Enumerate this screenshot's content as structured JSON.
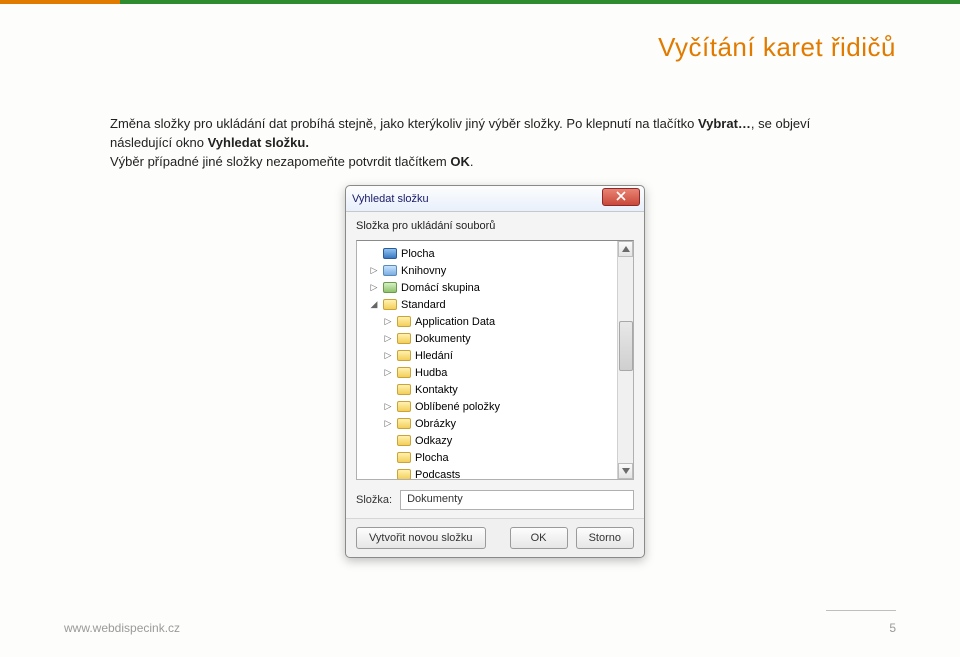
{
  "page": {
    "title": "Vyčítání karet řidičů",
    "paragraph_parts": {
      "p1a": "Změna složky pro ukládání dat probíhá stejně, jako kterýkoliv jiný výběr složky. Po klepnutí na tlačítko ",
      "p1b": "Vybrat…",
      "p1c": ", se objeví následující okno ",
      "p1d": "Vyhledat složku.",
      "p2a": "Výběr případné jiné složky nezapomeňte potvrdit tlačítkem ",
      "p2b": "OK",
      "p2c": "."
    },
    "footer_url": "www.webdispecink.cz",
    "footer_page": "5"
  },
  "dialog": {
    "title": "Vyhledat složku",
    "subtitle": "Složka pro ukládání souborů",
    "folder_label": "Složka:",
    "folder_value": "Dokumenty",
    "btn_new_folder": "Vytvořit novou složku",
    "btn_ok": "OK",
    "btn_cancel": "Storno",
    "tree": [
      {
        "level": 1,
        "expander": "",
        "icon": "desktop",
        "label": "Plocha"
      },
      {
        "level": 1,
        "expander": "▷",
        "icon": "lib",
        "label": "Knihovny"
      },
      {
        "level": 1,
        "expander": "▷",
        "icon": "group",
        "label": "Domácí skupina"
      },
      {
        "level": 1,
        "expander": "◢",
        "icon": "folder",
        "label": "Standard"
      },
      {
        "level": 2,
        "expander": "▷",
        "icon": "folder",
        "label": "Application Data"
      },
      {
        "level": 2,
        "expander": "▷",
        "icon": "folder",
        "label": "Dokumenty"
      },
      {
        "level": 2,
        "expander": "▷",
        "icon": "folder",
        "label": "Hledání"
      },
      {
        "level": 2,
        "expander": "▷",
        "icon": "folder",
        "label": "Hudba"
      },
      {
        "level": 2,
        "expander": "",
        "icon": "folder",
        "label": "Kontakty"
      },
      {
        "level": 2,
        "expander": "▷",
        "icon": "folder",
        "label": "Oblíbené položky"
      },
      {
        "level": 2,
        "expander": "▷",
        "icon": "folder",
        "label": "Obrázky"
      },
      {
        "level": 2,
        "expander": "",
        "icon": "folder",
        "label": "Odkazy"
      },
      {
        "level": 2,
        "expander": "",
        "icon": "folder",
        "label": "Plocha"
      },
      {
        "level": 2,
        "expander": "",
        "icon": "folder",
        "label": "Podcasts"
      }
    ]
  }
}
